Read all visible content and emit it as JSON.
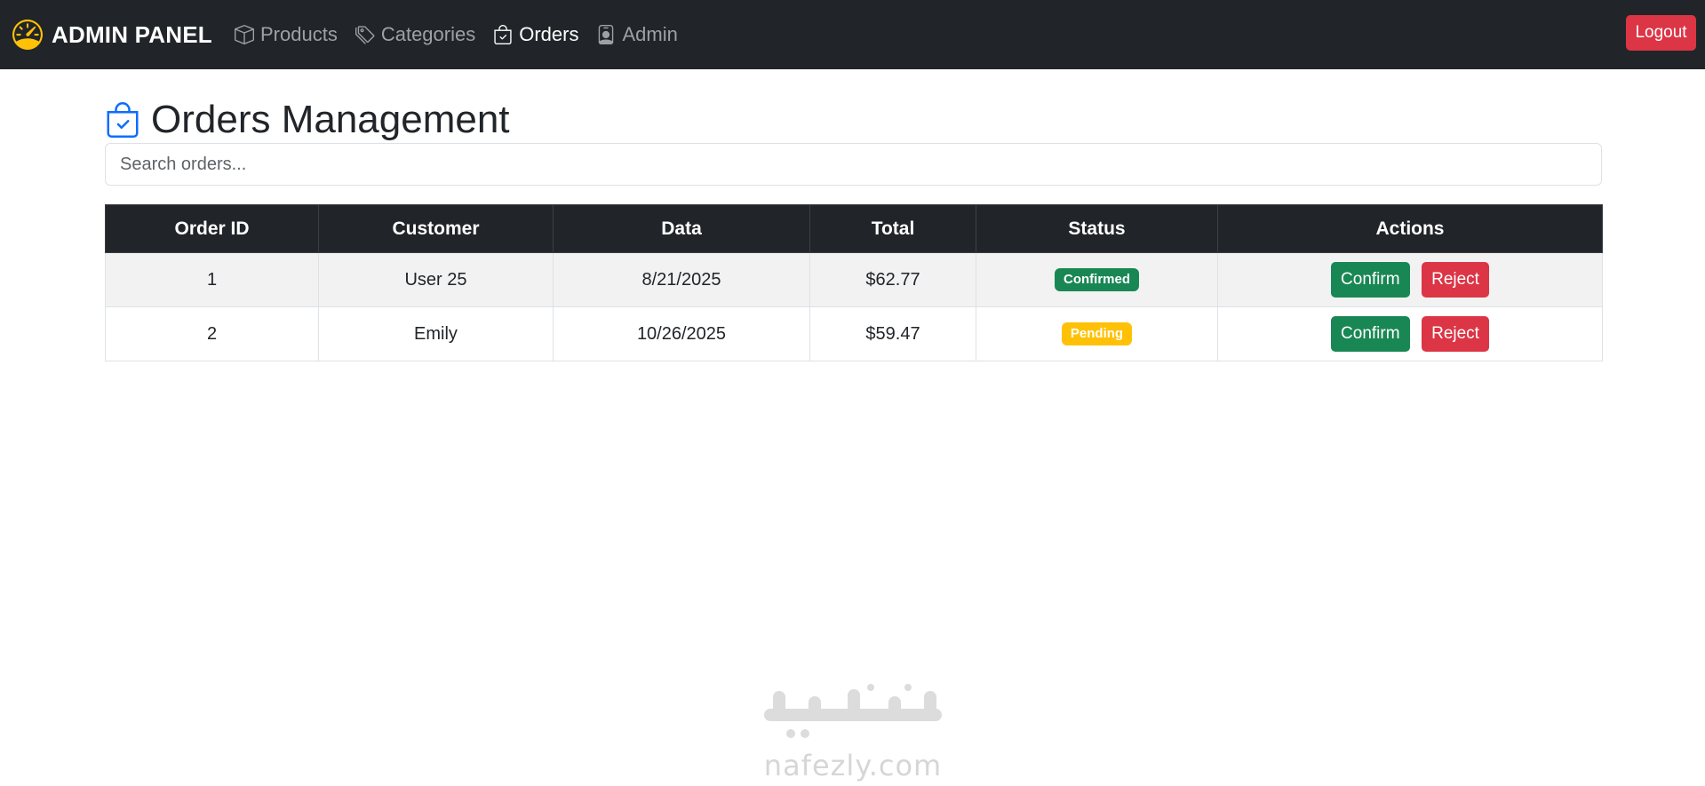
{
  "navbar": {
    "brand": "ADMIN PANEL",
    "brand_icon": "speedometer-icon",
    "brand_icon_color": "#ffc107",
    "links": [
      {
        "label": "Products",
        "icon": "box-icon",
        "active": false
      },
      {
        "label": "Categories",
        "icon": "tags-icon",
        "active": false
      },
      {
        "label": "Orders",
        "icon": "bag-check-icon",
        "active": true
      },
      {
        "label": "Admin",
        "icon": "person-badge-icon",
        "active": false
      }
    ],
    "logout_label": "Logout"
  },
  "page": {
    "title": "Orders Management",
    "title_icon": "bag-check-icon",
    "title_icon_color": "#0d6efd"
  },
  "search": {
    "placeholder": "Search orders...",
    "value": ""
  },
  "table": {
    "headers": [
      "Order ID",
      "Customer",
      "Data",
      "Total",
      "Status",
      "Actions"
    ],
    "rows": [
      {
        "id": "1",
        "customer": "User 25",
        "date": "8/21/2025",
        "total": "$62.77",
        "status": "Confirmed",
        "status_color": "#198754",
        "confirm_label": "Confirm",
        "reject_label": "Reject"
      },
      {
        "id": "2",
        "customer": "Emily",
        "date": "10/26/2025",
        "total": "$59.47",
        "status": "Pending",
        "status_color": "#ffc107",
        "confirm_label": "Confirm",
        "reject_label": "Reject"
      }
    ]
  },
  "watermark": {
    "arabic": "نفذلي",
    "text": "nafezly.com"
  },
  "colors": {
    "navbar_bg": "#212529",
    "danger": "#dc3545",
    "success": "#198754",
    "warning": "#ffc107"
  }
}
